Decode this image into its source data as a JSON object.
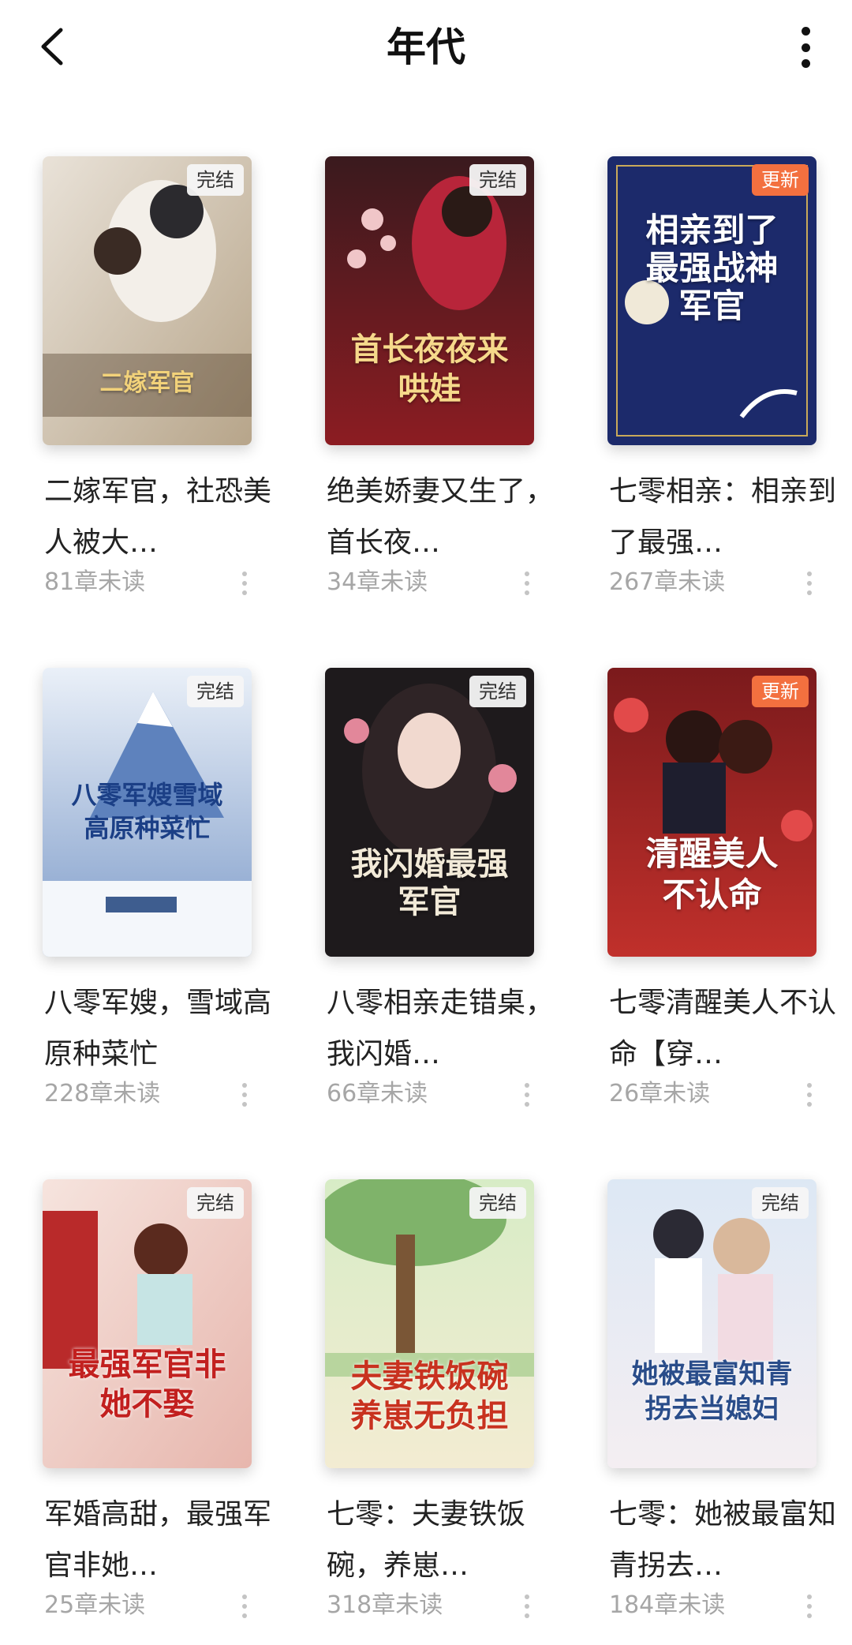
{
  "header": {
    "title": "年代",
    "back_icon": "chevron-left-icon",
    "more_icon": "more-vertical-icon"
  },
  "colors": {
    "update_badge": "#f3703f",
    "done_badge": "#f5f5f5",
    "meta_text": "#a6a6a6"
  },
  "books": [
    {
      "title": "二嫁军官，社恐美人被大…",
      "badge": "完结",
      "meta": "81章未读",
      "cover_text": "二嫁军官"
    },
    {
      "title": "绝美娇妻又生了，首长夜…",
      "badge": "完结",
      "meta": "34章未读",
      "cover_text": "首长夜夜来哄娃"
    },
    {
      "title": "七零相亲：相亲到了最强…",
      "badge": "更新",
      "meta": "267章未读",
      "cover_text": "相亲到了最强战神军官"
    },
    {
      "title": "八零军嫂，雪域高原种菜忙",
      "badge": "完结",
      "meta": "228章未读",
      "cover_text": "八零军嫂雪域高原种菜忙"
    },
    {
      "title": "八零相亲走错桌，我闪婚…",
      "badge": "完结",
      "meta": "66章未读",
      "cover_text": "我闪婚最强军官"
    },
    {
      "title": "七零清醒美人不认命【穿…",
      "badge": "更新",
      "meta": "26章未读",
      "cover_text": "清醒美人不认命"
    },
    {
      "title": "军婚高甜，最强军官非她…",
      "badge": "完结",
      "meta": "25章未读",
      "cover_text": "最强军官非她不娶"
    },
    {
      "title": "七零：夫妻铁饭碗，养崽…",
      "badge": "完结",
      "meta": "318章未读",
      "cover_text": "夫妻铁饭碗养崽无负担"
    },
    {
      "title": "七零：她被最富知青拐去…",
      "badge": "完结",
      "meta": "184章未读",
      "cover_text": "她被最富知青拐去当媳妇"
    }
  ]
}
